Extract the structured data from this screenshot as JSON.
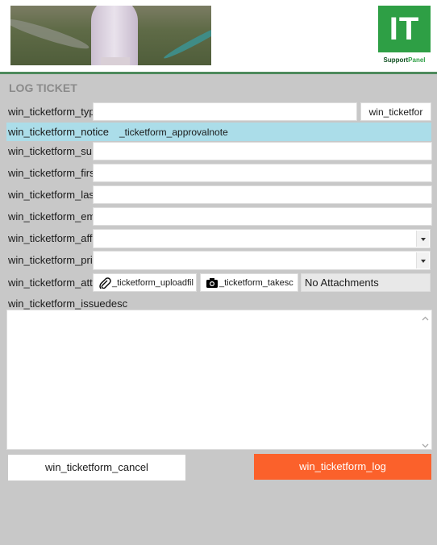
{
  "header": {
    "banner_image": "photo-banner",
    "logo_big": "IT",
    "logo_sub_a": "Support",
    "logo_sub_b": "Panel",
    "accent_color": "#2e9f45"
  },
  "form": {
    "title": "LOG TICKET",
    "type_label": "win_ticketform_typ",
    "type_value": "",
    "type_button": "win_ticketfor",
    "notice_label": "win_ticketform_notice",
    "notice_text": "_ticketform_approvalnote",
    "subject_label": "win_ticketform_su",
    "first_label": "win_ticketform_firs",
    "last_label": "win_ticketform_las",
    "email_label": "win_ticketform_em",
    "affected_label": "win_ticketform_aff",
    "priority_label": "win_ticketform_pri",
    "attach_label": "win_ticketform_att",
    "upload_button": "_ticketform_uploadfil",
    "screenshot_button": "_ticketform_takesc",
    "attachments_status": "No Attachments",
    "issue_label": "win_ticketform_issuedesc",
    "cancel_button": "win_ticketform_cancel",
    "log_button": "win_ticketform_log",
    "log_color": "#fb612b",
    "notice_color": "#abdde9"
  }
}
